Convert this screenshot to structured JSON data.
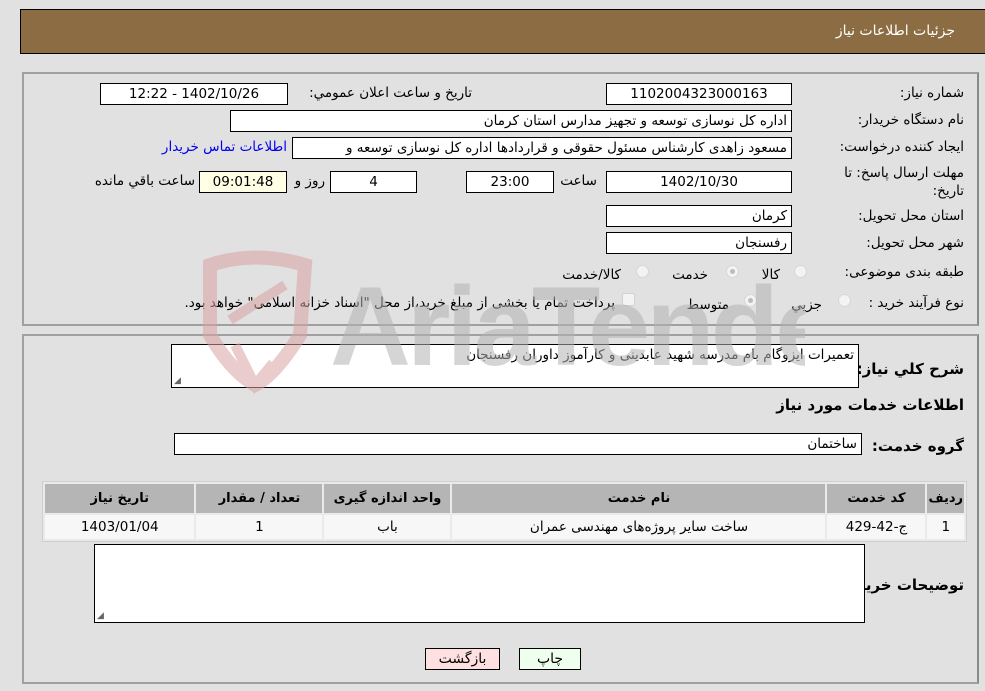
{
  "header": {
    "title": "جزئیات اطلاعات نیاز"
  },
  "details": {
    "need_number": {
      "label": "شماره نیاز:",
      "value": "1102004323000163"
    },
    "announce_datetime": {
      "label": "تاریخ و ساعت اعلان عمومي:",
      "value": "1402/10/26 - 12:22"
    },
    "buyer_org": {
      "label": "نام دستگاه خریدار:",
      "value": "اداره کل نوسازی  توسعه و تجهیز مدارس استان کرمان"
    },
    "requester": {
      "label": "ایجاد کننده درخواست:",
      "value": "مسعود زاهدی کارشناس مسئول حقوقی و قراردادها اداره کل نوسازی  توسعه و"
    },
    "buyer_contact_link": "اطلاعات تماس خریدار",
    "deadline": {
      "label": "مهلت ارسال پاسخ: تا تاریخ:",
      "date": "1402/10/30",
      "time_label": "ساعت",
      "time": "23:00",
      "days": "4",
      "days_label": "روز و",
      "remaining": "09:01:48",
      "remaining_label": "ساعت باقي مانده"
    },
    "province": {
      "label": "استان محل تحویل:",
      "value": "کرمان"
    },
    "city": {
      "label": "شهر محل تحویل:",
      "value": "رفسنجان"
    },
    "category": {
      "label": "طبقه بندی موضوعی:",
      "options": [
        "کالا",
        "خدمت",
        "کالا/خدمت"
      ],
      "selected": "خدمت"
    },
    "purchase_type": {
      "label": "نوع فرآیند خرید :",
      "options": [
        "جزيي",
        "متوسط"
      ],
      "selected": "متوسط",
      "treasury_checkbox_label": "پرداخت تمام یا بخشی از مبلغ خرید،از محل \"اسناد خزانه اسلامی\" خواهد بود.",
      "treasury_checked": false
    }
  },
  "description": {
    "label": "شرح کلي نیاز:",
    "value": "تعمیرات ایزوگام بام مدرسه شهید عابدینی و کارآموز داوران رفسنجان"
  },
  "services": {
    "section_title": "اطلاعات خدمات مورد نیاز",
    "group_label": "گروه خدمت:",
    "group_value": "ساختمان",
    "columns": [
      "ردیف",
      "کد خدمت",
      "نام خدمت",
      "واحد اندازه گیری",
      "تعداد / مقدار",
      "تاریخ نیاز"
    ],
    "rows": [
      {
        "row": "1",
        "code": "ج-42-429",
        "name": "ساخت سایر پروژه‌های مهندسی عمران",
        "unit": "باب",
        "qty": "1",
        "date": "1403/01/04"
      }
    ]
  },
  "buyer_notes": {
    "label": "توضیحات خریدار:",
    "value": ""
  },
  "buttons": {
    "print": "چاپ",
    "back": "بازگشت"
  },
  "watermark": {
    "text": "AriaTender.neT"
  },
  "colors": {
    "header_bg": "#8c6c42",
    "print_bg": "#eeffee",
    "back_bg": "#ffe0e0",
    "remaining_bg": "#ffffe6"
  }
}
